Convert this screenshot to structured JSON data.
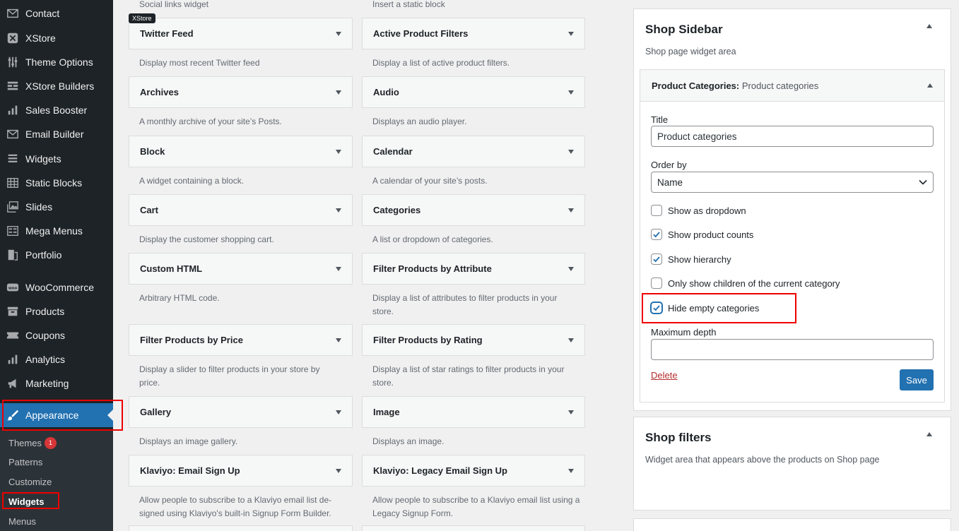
{
  "sidebar": {
    "items": [
      {
        "label": "Contact",
        "icon": "envelope-icon"
      },
      {
        "label": "XStore",
        "icon": "xstore-icon"
      },
      {
        "label": "Theme Options",
        "icon": "sliders-icon"
      },
      {
        "label": "XStore Builders",
        "icon": "builder-grid-icon"
      },
      {
        "label": "Sales Booster",
        "icon": "bar-chart-icon"
      },
      {
        "label": "Email Builder",
        "icon": "envelope-icon"
      },
      {
        "label": "Widgets",
        "icon": "list-icon"
      },
      {
        "label": "Static Blocks",
        "icon": "table-icon"
      },
      {
        "label": "Slides",
        "icon": "gallery-icon"
      },
      {
        "label": "Mega Menus",
        "icon": "mega-menu-icon"
      },
      {
        "label": "Portfolio",
        "icon": "portfolio-icon"
      },
      {
        "label": "WooCommerce",
        "icon": "woo-icon"
      },
      {
        "label": "Products",
        "icon": "archive-icon"
      },
      {
        "label": "Coupons",
        "icon": "ticket-icon"
      },
      {
        "label": "Analytics",
        "icon": "bar-chart-icon"
      },
      {
        "label": "Marketing",
        "icon": "megaphone-icon"
      },
      {
        "label": "Appearance",
        "icon": "paintbrush-icon"
      }
    ],
    "submenu": [
      {
        "label": "Themes",
        "badge": "1"
      },
      {
        "label": "Patterns"
      },
      {
        "label": "Customize"
      },
      {
        "label": "Widgets"
      },
      {
        "label": "Menus"
      }
    ]
  },
  "widgets": {
    "tooltip": "XStore",
    "top_left_desc": "Social links widget",
    "top_right_desc": "Insert a static block",
    "list": [
      {
        "title": "Twitter Feed",
        "desc": "Display most recent Twitter feed"
      },
      {
        "title": "Active Product Filters",
        "desc": "Display a list of active product filters."
      },
      {
        "title": "Archives",
        "desc": "A monthly archive of your site’s Posts."
      },
      {
        "title": "Audio",
        "desc": "Displays an audio player."
      },
      {
        "title": "Block",
        "desc": "A widget containing a block."
      },
      {
        "title": "Calendar",
        "desc": "A calendar of your site’s posts."
      },
      {
        "title": "Cart",
        "desc": "Display the customer shopping cart."
      },
      {
        "title": "Categories",
        "desc": "A list or dropdown of categories."
      },
      {
        "title": "Custom HTML",
        "desc": "Arbitrary HTML code."
      },
      {
        "title": "Filter Products by Attribute",
        "desc": "Display a list of attributes to filter products in your store."
      },
      {
        "title": "Filter Products by Price",
        "desc": "Display a slider to filter products in your store by price."
      },
      {
        "title": "Filter Products by Rating",
        "desc": "Display a list of star ratings to filter products in your store."
      },
      {
        "title": "Gallery",
        "desc": "Displays an image gallery."
      },
      {
        "title": "Image",
        "desc": "Displays an image."
      },
      {
        "title": "Klaviyo: Email Sign Up",
        "desc": "Allow people to subscribe to a Klaviyo email list de-signed using Klaviyo's built-in Signup Form Builder."
      },
      {
        "title": "Klaviyo: Legacy Email Sign Up",
        "desc": "Allow people to subscribe to a Klaviyo email list using a Legacy Signup Form."
      }
    ]
  },
  "shop_sidebar": {
    "title": "Shop Sidebar",
    "desc": "Shop page widget area",
    "widget": {
      "head_name": "Product Categories:",
      "head_sub": "Product categories",
      "title_label": "Title",
      "title_value": "Product categories",
      "orderby_label": "Order by",
      "orderby_value": "Name",
      "checkboxes": [
        {
          "label": "Show as dropdown",
          "checked": false
        },
        {
          "label": "Show product counts",
          "checked": true
        },
        {
          "label": "Show hierarchy",
          "checked": true
        },
        {
          "label": "Only show children of the current category",
          "checked": false
        },
        {
          "label": "Hide empty categories",
          "checked": true
        }
      ],
      "max_depth_label": "Maximum depth",
      "max_depth_value": "",
      "delete_label": "Delete",
      "save_label": "Save"
    }
  },
  "shop_filters": {
    "title": "Shop filters",
    "desc": "Widget area that appears above the products on Shop page"
  },
  "colors": {
    "sidebar_bg": "#1d2327",
    "accent": "#2271b1",
    "highlight_box": "#e00000",
    "checkbox_check": "#2271b1"
  }
}
